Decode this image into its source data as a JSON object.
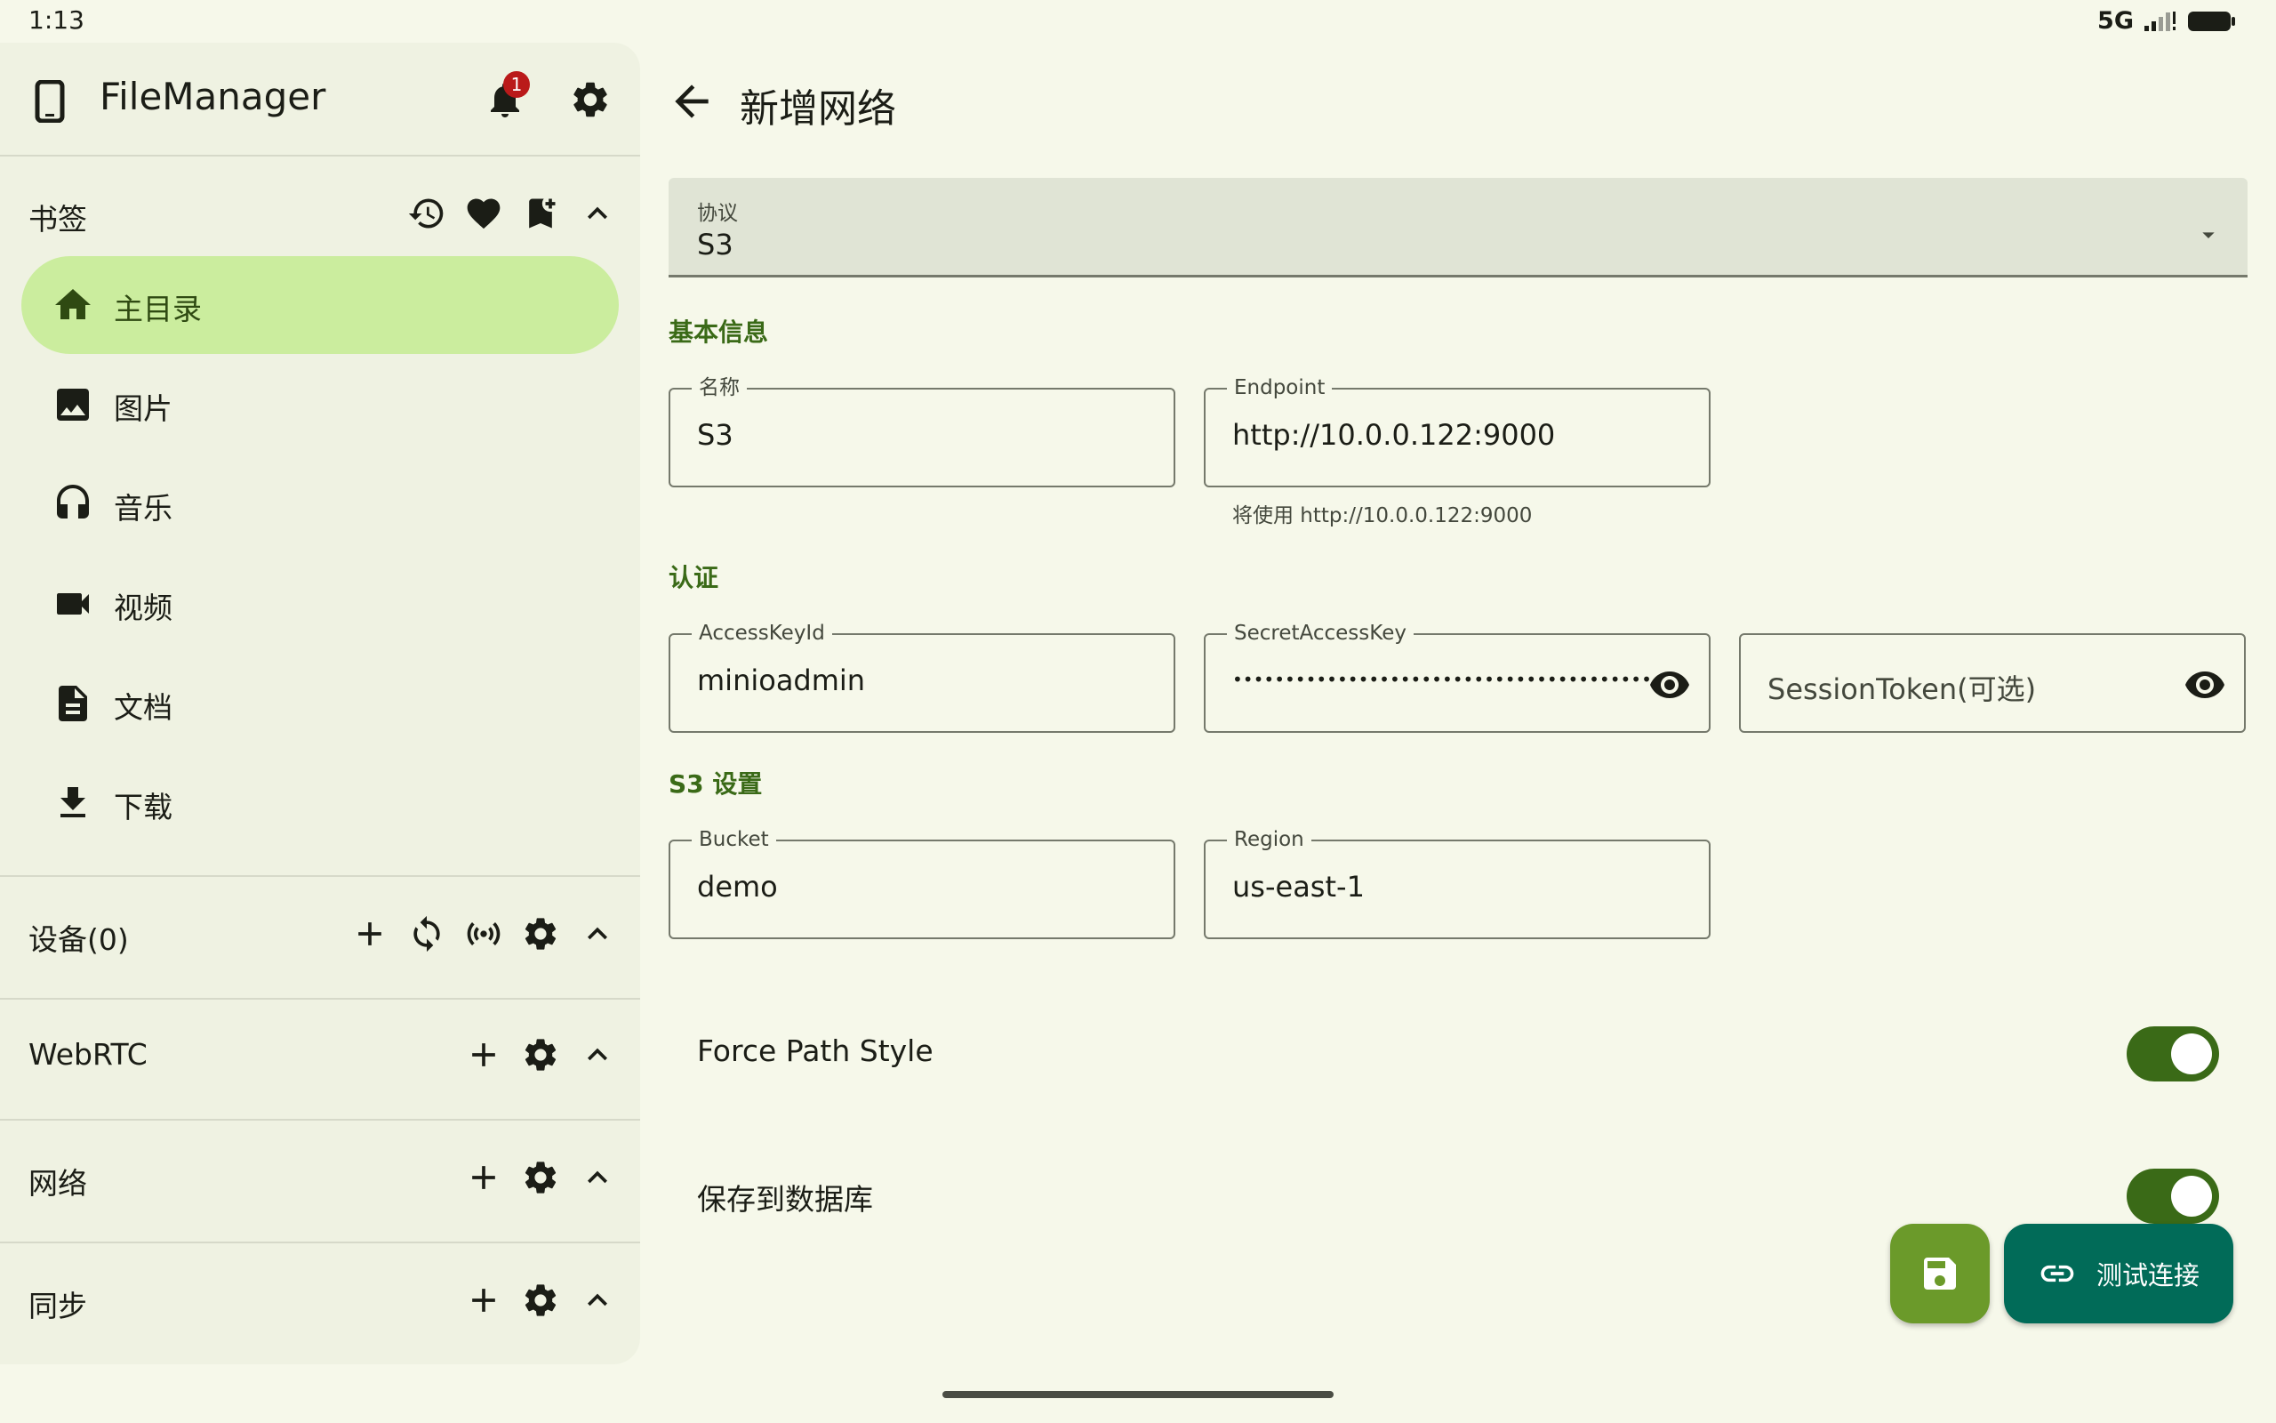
{
  "status_bar": {
    "time": "1:13",
    "network": "5G"
  },
  "sidebar": {
    "app_title": "FileManager",
    "notification_count": "1",
    "bookmarks": {
      "title": "书签",
      "items": [
        {
          "label": "主目录",
          "icon": "home-icon",
          "active": true
        },
        {
          "label": "图片",
          "icon": "image-icon"
        },
        {
          "label": "音乐",
          "icon": "headphones-icon"
        },
        {
          "label": "视频",
          "icon": "video-icon"
        },
        {
          "label": "文档",
          "icon": "document-icon"
        },
        {
          "label": "下载",
          "icon": "download-icon"
        }
      ]
    },
    "devices": {
      "title": "设备(0)"
    },
    "webrtc": {
      "title": "WebRTC"
    },
    "network": {
      "title": "网络"
    },
    "sync": {
      "title": "同步"
    }
  },
  "main": {
    "title": "新增网络",
    "protocol": {
      "label": "协议",
      "value": "S3"
    },
    "basic_info": {
      "title": "基本信息",
      "name": {
        "label": "名称",
        "value": "S3"
      },
      "endpoint": {
        "label": "Endpoint",
        "value": "http://10.0.0.122:9000",
        "helper": "将使用 http://10.0.0.122:9000"
      }
    },
    "auth": {
      "title": "认证",
      "access_key_id": {
        "label": "AccessKeyId",
        "value": "minioadmin"
      },
      "secret_access_key": {
        "label": "SecretAccessKey",
        "value": "••••••••••••••••••••••••••••••••••••••••"
      },
      "session_token": {
        "placeholder": "SessionToken(可选)"
      }
    },
    "s3_settings": {
      "title": "S3 设置",
      "bucket": {
        "label": "Bucket",
        "value": "demo"
      },
      "region": {
        "label": "Region",
        "value": "us-east-1"
      }
    },
    "force_path_style": {
      "label": "Force Path Style",
      "on": true
    },
    "save_to_db": {
      "label": "保存到数据库",
      "on": true
    },
    "test_connection_label": "测试连接"
  },
  "colors": {
    "accent": "#3a6a17",
    "active_nav": "#cbed9e",
    "fab_save": "#6b9a2a",
    "fab_test": "#016b58",
    "badge": "#ba1a1a"
  }
}
